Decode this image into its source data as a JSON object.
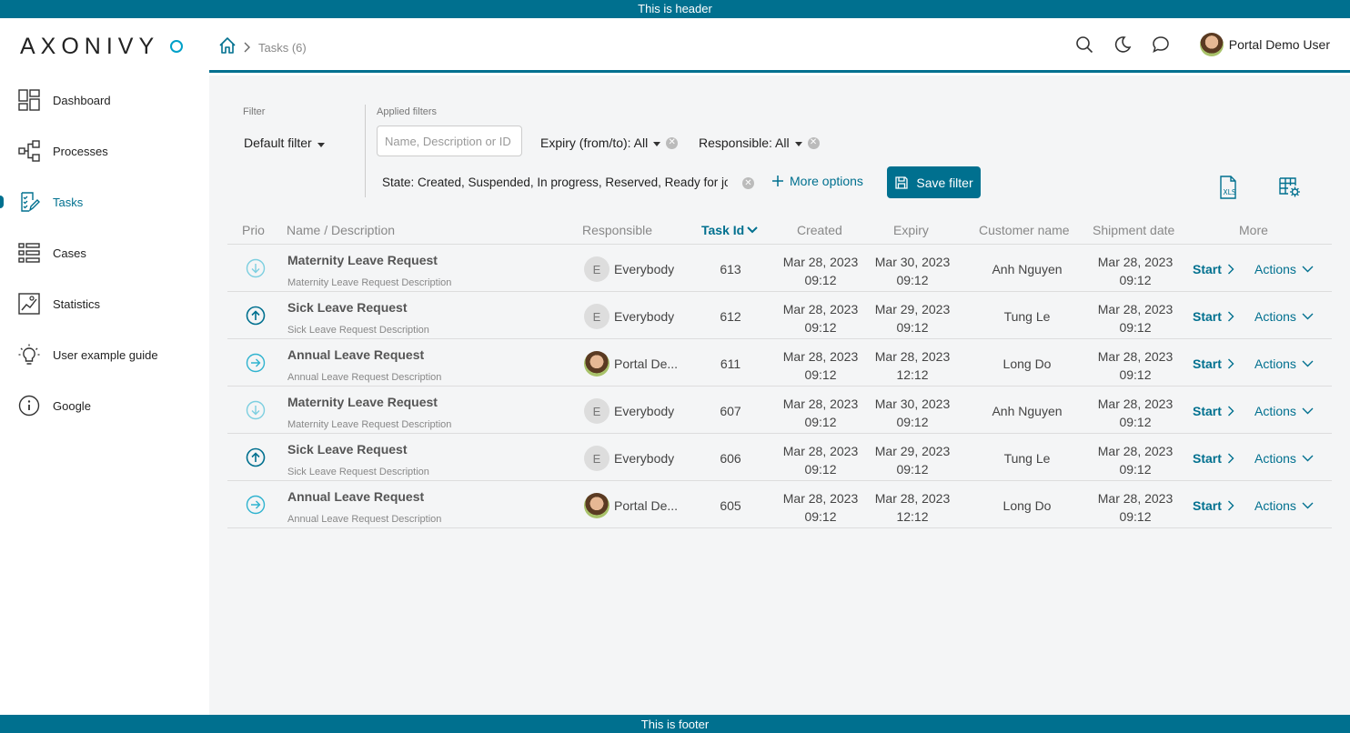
{
  "frame": {
    "header_text": "This is header",
    "footer_text": "This is footer"
  },
  "logo": {
    "text": "AXONIVY"
  },
  "sidebar": {
    "items": [
      {
        "label": "Dashboard",
        "icon": "dashboard-icon"
      },
      {
        "label": "Processes",
        "icon": "processes-icon"
      },
      {
        "label": "Tasks",
        "icon": "tasks-icon",
        "active": true
      },
      {
        "label": "Cases",
        "icon": "cases-icon"
      },
      {
        "label": "Statistics",
        "icon": "statistics-icon"
      },
      {
        "label": "User example guide",
        "icon": "lightbulb-icon"
      },
      {
        "label": "Google",
        "icon": "info-icon"
      }
    ]
  },
  "header": {
    "breadcrumb": {
      "current": "Tasks (6)"
    },
    "user_name": "Portal Demo User"
  },
  "filters": {
    "filter_label": "Filter",
    "default_filter": "Default filter",
    "applied_label": "Applied filters",
    "search_placeholder": "Name, Description or ID",
    "search_value": "",
    "expiry": "Expiry (from/to): All",
    "responsible": "Responsible: All",
    "state": "State: Created, Suspended, In progress, Reserved, Ready for jo",
    "more_options": "More options",
    "save_filter": "Save filter"
  },
  "table": {
    "headers": {
      "prio": "Prio",
      "name": "Name / Description",
      "responsible": "Responsible",
      "task_id": "Task Id",
      "created": "Created",
      "expiry": "Expiry",
      "customer": "Customer name",
      "shipment": "Shipment date",
      "more": "More"
    },
    "start_label": "Start",
    "actions_label": "Actions",
    "rows": [
      {
        "prio": "low",
        "name": "Maternity Leave Request",
        "desc": "Maternity Leave Request Description",
        "resp": "Everybody",
        "resp_initial": "E",
        "resp_photo": false,
        "id": "613",
        "created_date": "Mar 28, 2023",
        "created_time": "09:12",
        "expiry_date": "Mar 30, 2023",
        "expiry_time": "09:12",
        "customer": "Anh Nguyen",
        "ship_date": "Mar 28, 2023",
        "ship_time": "09:12"
      },
      {
        "prio": "high",
        "name": "Sick Leave Request",
        "desc": "Sick Leave Request Description",
        "resp": "Everybody",
        "resp_initial": "E",
        "resp_photo": false,
        "id": "612",
        "created_date": "Mar 28, 2023",
        "created_time": "09:12",
        "expiry_date": "Mar 29, 2023",
        "expiry_time": "09:12",
        "customer": "Tung Le",
        "ship_date": "Mar 28, 2023",
        "ship_time": "09:12"
      },
      {
        "prio": "normal",
        "name": "Annual Leave Request",
        "desc": "Annual Leave Request Description",
        "resp": "Portal De...",
        "resp_initial": "",
        "resp_photo": true,
        "id": "611",
        "created_date": "Mar 28, 2023",
        "created_time": "09:12",
        "expiry_date": "Mar 28, 2023",
        "expiry_time": "12:12",
        "customer": "Long Do",
        "ship_date": "Mar 28, 2023",
        "ship_time": "09:12"
      },
      {
        "prio": "low",
        "name": "Maternity Leave Request",
        "desc": "Maternity Leave Request Description",
        "resp": "Everybody",
        "resp_initial": "E",
        "resp_photo": false,
        "id": "607",
        "created_date": "Mar 28, 2023",
        "created_time": "09:12",
        "expiry_date": "Mar 30, 2023",
        "expiry_time": "09:12",
        "customer": "Anh Nguyen",
        "ship_date": "Mar 28, 2023",
        "ship_time": "09:12"
      },
      {
        "prio": "high",
        "name": "Sick Leave Request",
        "desc": "Sick Leave Request Description",
        "resp": "Everybody",
        "resp_initial": "E",
        "resp_photo": false,
        "id": "606",
        "created_date": "Mar 28, 2023",
        "created_time": "09:12",
        "expiry_date": "Mar 29, 2023",
        "expiry_time": "09:12",
        "customer": "Tung Le",
        "ship_date": "Mar 28, 2023",
        "ship_time": "09:12"
      },
      {
        "prio": "normal",
        "name": "Annual Leave Request",
        "desc": "Annual Leave Request Description",
        "resp": "Portal De...",
        "resp_initial": "",
        "resp_photo": true,
        "id": "605",
        "created_date": "Mar 28, 2023",
        "created_time": "09:12",
        "expiry_date": "Mar 28, 2023",
        "expiry_time": "12:12",
        "customer": "Long Do",
        "ship_date": "Mar 28, 2023",
        "ship_time": "09:12"
      }
    ]
  },
  "colors": {
    "accent": "#00708f",
    "prio_low": "#7ccfe0",
    "prio_high": "#00708f",
    "prio_normal": "#2fb3cf"
  }
}
